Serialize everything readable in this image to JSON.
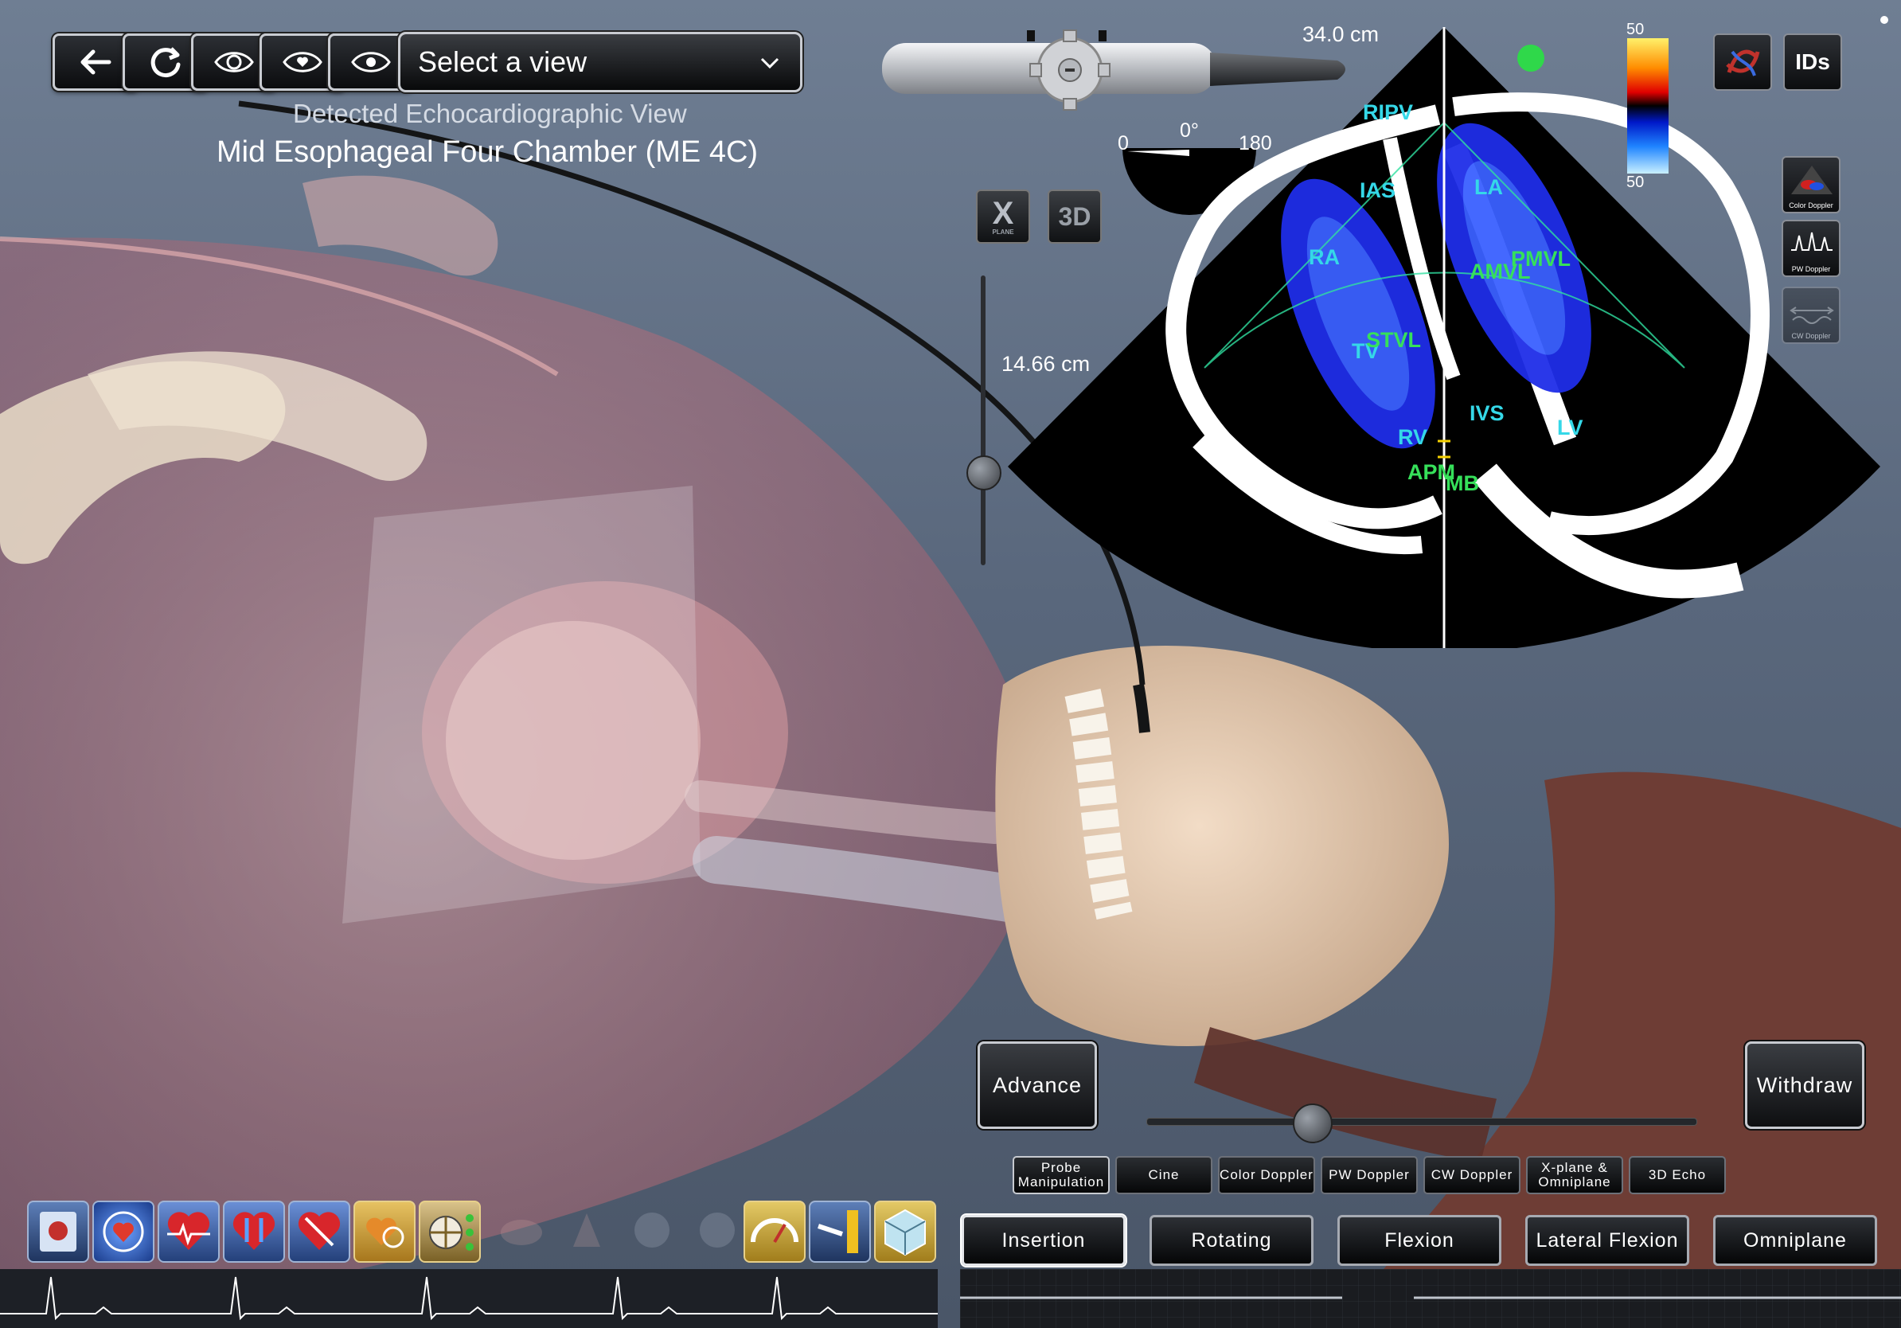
{
  "toolbar": {
    "view_select_label": "Select a view",
    "detected_label": "Detected Echocardiographic View",
    "detected_view": "Mid Esophageal Four Chamber (ME 4C)"
  },
  "probe": {
    "depth": "34.0 cm",
    "angle_min": "0",
    "angle_current": "0°",
    "angle_max": "180",
    "insertion_depth": "14.66 cm",
    "xplane_label": "X",
    "xplane_sub": "PLANE",
    "threed_label": "3D"
  },
  "echo": {
    "labels_cyan": [
      "RIPV",
      "IAS",
      "LA",
      "RA",
      "TV",
      "RV",
      "IVS",
      "LV"
    ],
    "labels_green": [
      "PMVL",
      "AMVL",
      "STVL",
      "APM",
      "MB"
    ],
    "color_scale_top": "50",
    "color_scale_bottom": "50"
  },
  "right_panel": {
    "ids_label": "IDs",
    "color_doppler": "Color Doppler",
    "pw_doppler": "PW Doppler",
    "cw_doppler": "CW Doppler"
  },
  "controls": {
    "advance": "Advance",
    "withdraw": "Withdraw",
    "slider_value": 0.3,
    "modes": [
      "Probe Manipulation",
      "Cine",
      "Color Doppler",
      "PW Doppler",
      "CW Doppler",
      "X-plane & Omniplane",
      "3D Echo"
    ],
    "motions": [
      "Insertion",
      "Rotating",
      "Flexion",
      "Lateral Flexion",
      "Omniplane"
    ]
  },
  "colors": {
    "doppler_cyan": "#35d8e8",
    "doppler_green": "#36e05a",
    "indicator_green": "#2fd84a"
  }
}
